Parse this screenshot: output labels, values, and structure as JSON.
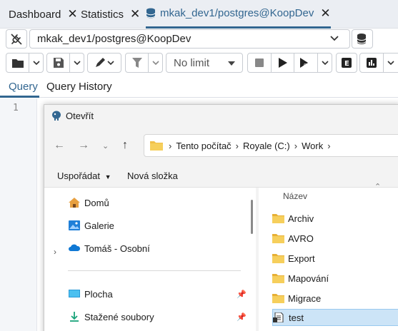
{
  "tabs": [
    {
      "label": "Dashboard",
      "close": "✕"
    },
    {
      "label": "Statistics",
      "close": "✕"
    },
    {
      "label": "mkak_dev1/postgres@KoopDev",
      "close": "✕",
      "active": true
    }
  ],
  "connection": {
    "value": "mkak_dev1/postgres@KoopDev"
  },
  "toolbar": {
    "limit_value": "No limit"
  },
  "query_tabs": [
    {
      "label": "Query",
      "active": true
    },
    {
      "label": "Query History"
    }
  ],
  "editor": {
    "line_number": "1"
  },
  "dialog": {
    "title": "Otevřít",
    "breadcrumb": [
      "Tento počítač",
      "Royale (C:)",
      "Work"
    ],
    "commands": {
      "organize": "Uspořádat",
      "new_folder": "Nová složka"
    },
    "nav_items": [
      {
        "label": "Domů",
        "icon": "home-icon"
      },
      {
        "label": "Galerie",
        "icon": "gallery-icon"
      },
      {
        "label": "Tomáš - Osobní",
        "icon": "onedrive-cloud-icon"
      },
      {
        "label": "Plocha",
        "icon": "desktop-icon",
        "pinned": true
      },
      {
        "label": "Stažené soubory",
        "icon": "download-icon",
        "pinned": true
      }
    ],
    "column_header": "Název",
    "files": [
      {
        "name": "Archiv",
        "type": "folder"
      },
      {
        "name": "AVRO",
        "type": "folder"
      },
      {
        "name": "Export",
        "type": "folder"
      },
      {
        "name": "Mapování",
        "type": "folder"
      },
      {
        "name": "Migrace",
        "type": "folder"
      },
      {
        "name": "test",
        "type": "file",
        "selected": true
      }
    ]
  },
  "colors": {
    "accent": "#326690",
    "folder": "#f0c04a",
    "selection": "#cce4f7"
  }
}
